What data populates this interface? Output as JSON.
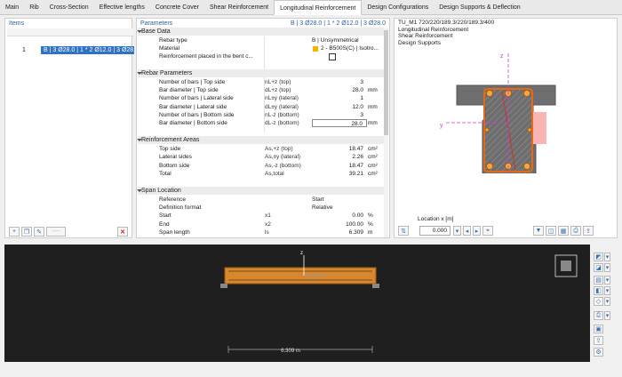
{
  "tabs": [
    "Main",
    "Rib",
    "Cross-Section",
    "Effective lengths",
    "Concrete Cover",
    "Shear Reinforcement",
    "Longitudinal Reinforcement",
    "Design Configurations",
    "Design Supports & Deflection"
  ],
  "active_tab": 6,
  "items": {
    "title": "Items",
    "rows": [
      {
        "num": "1",
        "value": "B | 3 Ø28.0 | 1 * 2 Ø12.0 | 3 Ø28.0"
      }
    ],
    "disabled_btn": "----"
  },
  "params": {
    "title": "Parameters",
    "header_right": "B | 3 Ø28.0 | 1 * 2 Ø12.0 | 3 Ø28.0",
    "sections": {
      "base": "Base Data",
      "rebar": "Rebar Parameters",
      "areas": "Reinforcement Areas",
      "span": "Span Location"
    },
    "base_rows": [
      {
        "label": "Rebar type",
        "value": "B | Unsymmetrical"
      },
      {
        "label": "Material",
        "value": "2 - B500S(C) | Isotro..."
      },
      {
        "label": "Reinforcement placed in the bent c..."
      }
    ],
    "rebar_rows": [
      {
        "label": "Number of bars | Top side",
        "sym": "nL+z (top)",
        "value": "3",
        "unit": ""
      },
      {
        "label": "Bar diameter | Top side",
        "sym": "dL+z (top)",
        "value": "28.0",
        "unit": "mm"
      },
      {
        "label": "Number of bars | Lateral side",
        "sym": "nL±y (lateral)",
        "value": "1",
        "unit": ""
      },
      {
        "label": "Bar diameter | Lateral side",
        "sym": "dL±y (lateral)",
        "value": "12.0",
        "unit": "mm"
      },
      {
        "label": "Number of bars | Bottom side",
        "sym": "nL-z (bottom)",
        "value": "3",
        "unit": ""
      },
      {
        "label": "Bar diameter | Bottom side",
        "sym": "dL-z (bottom)",
        "value": "28.0",
        "unit": "mm"
      }
    ],
    "area_rows": [
      {
        "label": "Top side",
        "sym": "As,+z (top)",
        "value": "18.47",
        "unit": "cm²"
      },
      {
        "label": "Lateral sides",
        "sym": "As,±y (lateral)",
        "value": "2.26",
        "unit": "cm²"
      },
      {
        "label": "Bottom side",
        "sym": "As,-z (bottom)",
        "value": "18.47",
        "unit": "cm²"
      },
      {
        "label": "Total",
        "sym": "As,total",
        "value": "39.21",
        "unit": "cm²"
      }
    ],
    "span_rows": [
      {
        "label": "Reference",
        "value": "Start",
        "unit": ""
      },
      {
        "label": "Definition format",
        "value": "Relative",
        "unit": ""
      },
      {
        "label": "Start",
        "sym": "x1",
        "value": "0.00",
        "unit": "%"
      },
      {
        "label": "End",
        "sym": "x2",
        "value": "100.00",
        "unit": "%"
      },
      {
        "label": "Span length",
        "sym": "ls",
        "value": "6.309",
        "unit": "m"
      }
    ]
  },
  "preview": {
    "lines": [
      "TU_M1 720/220/189.3/220/189.3/400",
      "Longitudinal Reinforcement",
      "Shear Reinforcement",
      "Design Supports"
    ],
    "axis_z": "z",
    "axis_y": "y",
    "location_label": "Location x [m]",
    "location_value": "0.000"
  },
  "view3d": {
    "axis_z": "z",
    "axis_x": "x",
    "dimension": "6.309 m"
  },
  "colors": {
    "accent": "#2f72c4",
    "section": "#6e6e6e",
    "rebar": "#e36b17",
    "axis": "#d43bd4",
    "support": "#f7b5b5",
    "beam": "#d7882c"
  }
}
